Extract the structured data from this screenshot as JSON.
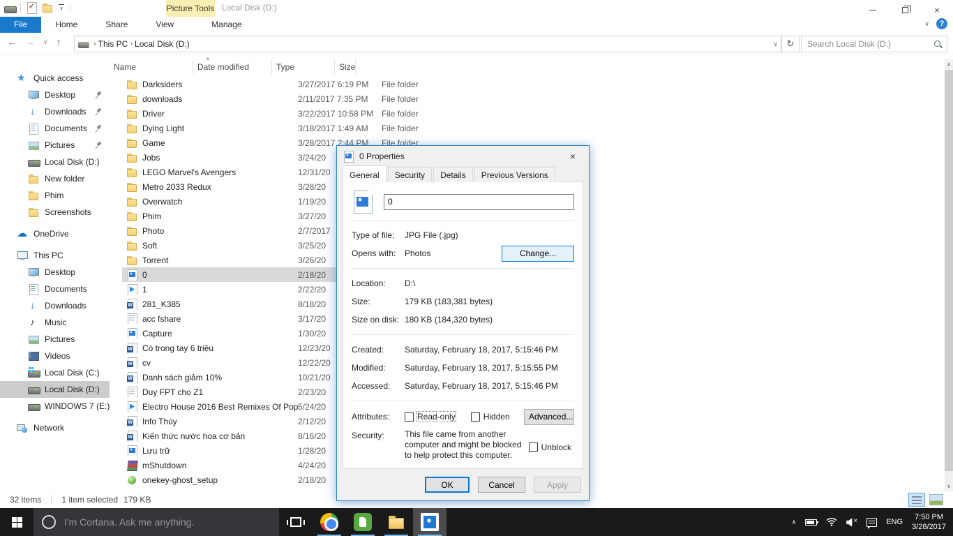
{
  "colors": {
    "accent": "#0078d7",
    "file_tab_blue": "#1979ca",
    "contextual_tab_yellow": "#f8edb3",
    "taskbar_dark": "#1a1a1a",
    "selection_gray": "#d9d9d9",
    "sidebar_selection": "#cccccc"
  },
  "icons": {
    "back": "←",
    "forward": "→",
    "up": "↑",
    "refresh": "↻",
    "chevron_down": "∨",
    "chevron_up": "∧",
    "help": "?",
    "close": "×",
    "breadcrumb_sep": "›",
    "sort_asc": "∧",
    "qat": [
      "explorer",
      "properties",
      "new-folder",
      "customize"
    ]
  },
  "titlebar": {
    "contextual_tab": "Picture Tools",
    "title": "Local Disk (D:)"
  },
  "ribbon": {
    "tabs": [
      {
        "label": "File",
        "active": true
      },
      {
        "label": "Home"
      },
      {
        "label": "Share"
      },
      {
        "label": "View"
      },
      {
        "label": "Manage",
        "contextual": true
      }
    ]
  },
  "address_bar": {
    "breadcrumbs": [
      {
        "label": "This PC"
      },
      {
        "label": "Local Disk (D:)"
      }
    ],
    "search_placeholder": "Search Local Disk (D:)"
  },
  "sidebar": {
    "entries": [
      {
        "label": "Quick access",
        "icon": "star",
        "kind": "header"
      },
      {
        "label": "Desktop",
        "icon": "monitor",
        "kind": "item",
        "pinned": true
      },
      {
        "label": "Downloads",
        "icon": "down",
        "kind": "item",
        "pinned": true
      },
      {
        "label": "Documents",
        "icon": "doc",
        "kind": "item",
        "pinned": true
      },
      {
        "label": "Pictures",
        "icon": "img",
        "kind": "item",
        "pinned": true
      },
      {
        "label": "Local Disk (D:)",
        "icon": "drive",
        "kind": "item"
      },
      {
        "label": "New folder",
        "icon": "folder",
        "kind": "item"
      },
      {
        "label": "Phim",
        "icon": "folder",
        "kind": "item"
      },
      {
        "label": "Screenshots",
        "icon": "folder",
        "kind": "item"
      },
      {
        "label": "OneDrive",
        "icon": "cloud",
        "kind": "header"
      },
      {
        "label": "This PC",
        "icon": "pc",
        "kind": "header"
      },
      {
        "label": "Desktop",
        "icon": "monitor",
        "kind": "item"
      },
      {
        "label": "Documents",
        "icon": "doc",
        "kind": "item"
      },
      {
        "label": "Downloads",
        "icon": "down",
        "kind": "item"
      },
      {
        "label": "Music",
        "icon": "music",
        "kind": "item"
      },
      {
        "label": "Pictures",
        "icon": "img",
        "kind": "item"
      },
      {
        "label": "Videos",
        "icon": "film",
        "kind": "item"
      },
      {
        "label": "Local Disk (C:)",
        "icon": "drivec",
        "kind": "item"
      },
      {
        "label": "Local Disk (D:)",
        "icon": "drive",
        "kind": "item",
        "selected": true
      },
      {
        "label": "WINDOWS 7 (E:)",
        "icon": "drive",
        "kind": "item"
      },
      {
        "label": "Network",
        "icon": "network",
        "kind": "header"
      }
    ]
  },
  "file_list": {
    "columns": [
      "Name",
      "Date modified",
      "Type",
      "Size"
    ],
    "rows": [
      {
        "name": "Darksiders",
        "icon": "folder",
        "date": "3/27/2017 6:19 PM",
        "type": "File folder"
      },
      {
        "name": "downloads",
        "icon": "folder",
        "date": "2/11/2017 7:35 PM",
        "type": "File folder"
      },
      {
        "name": "Driver",
        "icon": "folder",
        "date": "3/22/2017 10:58 PM",
        "type": "File folder"
      },
      {
        "name": "Dying Light",
        "icon": "folder",
        "date": "3/18/2017 1:49 AM",
        "type": "File folder"
      },
      {
        "name": "Game",
        "icon": "folder",
        "date": "3/28/2017 2:44 PM",
        "type": "File folder"
      },
      {
        "name": "Jobs",
        "icon": "folder",
        "date": "3/24/20"
      },
      {
        "name": "LEGO Marvel's Avengers",
        "icon": "folder",
        "date": "12/31/20"
      },
      {
        "name": "Metro 2033 Redux",
        "icon": "folder",
        "date": "3/28/20"
      },
      {
        "name": "Overwatch",
        "icon": "folder",
        "date": "1/19/20"
      },
      {
        "name": "Phim",
        "icon": "folder",
        "date": "3/27/20"
      },
      {
        "name": "Photo",
        "icon": "folder",
        "date": "2/7/2017"
      },
      {
        "name": "Soft",
        "icon": "folder",
        "date": "3/25/20"
      },
      {
        "name": "Torrent",
        "icon": "folder",
        "date": "3/26/20"
      },
      {
        "name": "0",
        "icon": "imgfile",
        "date": "2/18/20",
        "selected": true
      },
      {
        "name": "1",
        "icon": "media",
        "date": "2/22/20"
      },
      {
        "name": "281_K385",
        "icon": "word",
        "date": "8/18/20"
      },
      {
        "name": "acc fshare",
        "icon": "txt",
        "date": "3/17/20"
      },
      {
        "name": "Capture",
        "icon": "imgfile",
        "date": "1/30/20"
      },
      {
        "name": "Có trong tay 6 triệu",
        "icon": "word",
        "date": "12/23/20"
      },
      {
        "name": "cv",
        "icon": "word",
        "date": "12/22/20"
      },
      {
        "name": "Danh sách giảm 10%",
        "icon": "word",
        "date": "10/21/20"
      },
      {
        "name": "Duy FPT cho Z1",
        "icon": "txt",
        "date": "2/23/20"
      },
      {
        "name": "Electro House 2016 Best Remixes Of Pop...",
        "icon": "media",
        "date": "5/24/20"
      },
      {
        "name": "Info Thúy",
        "icon": "word",
        "date": "2/12/20"
      },
      {
        "name": "Kiến thức nước hoa cơ bản",
        "icon": "word",
        "date": "8/16/20"
      },
      {
        "name": "Lưu trữ",
        "icon": "imgfile",
        "date": "1/28/20"
      },
      {
        "name": "mShutdown",
        "icon": "rar",
        "date": "4/24/20"
      },
      {
        "name": "onekey-ghost_setup",
        "icon": "setup",
        "date": "2/18/20"
      }
    ]
  },
  "status_bar": {
    "count": "32 items",
    "selected": "1 item selected",
    "size": "179 KB"
  },
  "dialog": {
    "title": "0 Properties",
    "tabs": [
      {
        "label": "General",
        "active": true
      },
      {
        "label": "Security"
      },
      {
        "label": "Details"
      },
      {
        "label": "Previous Versions"
      }
    ],
    "name_value": "0",
    "type_label": "Type of file:",
    "type_value": "JPG File (.jpg)",
    "opens_label": "Opens with:",
    "opens_value": "Photos",
    "change_button": "Change...",
    "location_fields": [
      {
        "label": "Location:",
        "value": "D:\\"
      },
      {
        "label": "Size:",
        "value": "179 KB (183,381 bytes)"
      },
      {
        "label": "Size on disk:",
        "value": "180 KB (184,320 bytes)"
      }
    ],
    "time_fields": [
      {
        "label": "Created:",
        "value": "Saturday, February 18, 2017, 5:15:46 PM"
      },
      {
        "label": "Modified:",
        "value": "Saturday, February 18, 2017, 5:15:55 PM"
      },
      {
        "label": "Accessed:",
        "value": "Saturday, February 18, 2017, 5:15:46 PM"
      }
    ],
    "attributes_label": "Attributes:",
    "readonly_label": "Read-only",
    "hidden_label": "Hidden",
    "advanced_button": "Advanced...",
    "security_label": "Security:",
    "security_text": "This file came from another computer and might be blocked to help protect this computer.",
    "unblock_label": "Unblock",
    "ok_button": "OK",
    "cancel_button": "Cancel",
    "apply_button": "Apply"
  },
  "taskbar": {
    "cortana_placeholder": "I'm Cortana. Ask me anything.",
    "apps": [
      {
        "name": "task-view"
      },
      {
        "name": "chrome",
        "running": true
      },
      {
        "name": "evernote",
        "running": true
      },
      {
        "name": "file-explorer",
        "running": true
      },
      {
        "name": "photos",
        "running": true,
        "active": true
      }
    ],
    "tray": {
      "language": "ENG",
      "time": "7:50 PM",
      "date": "3/28/2017"
    }
  }
}
